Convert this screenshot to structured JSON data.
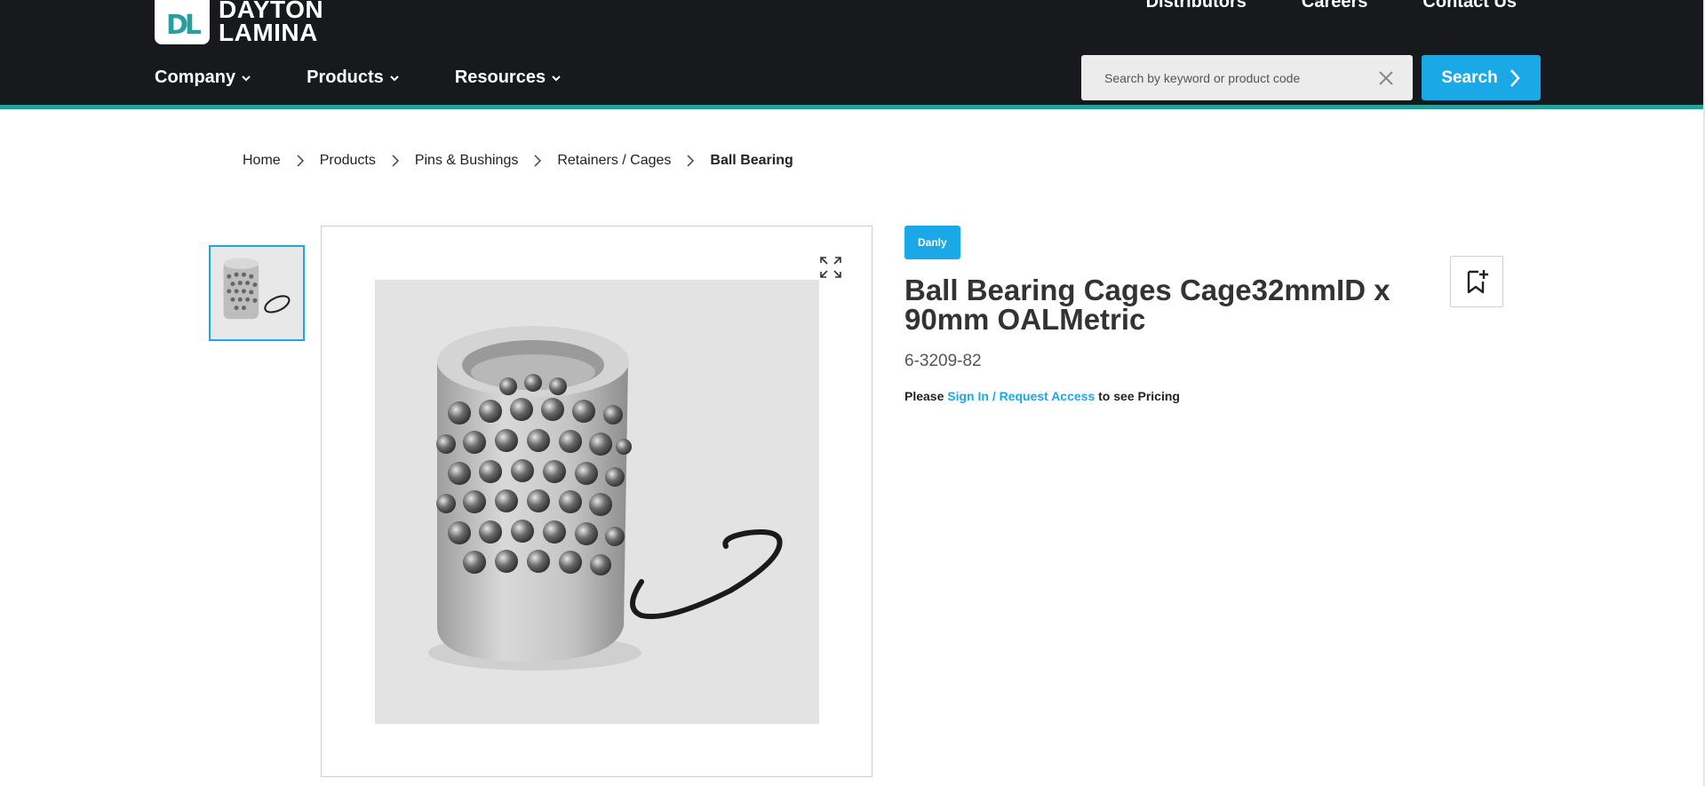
{
  "header": {
    "logo": {
      "line1": "DAYTON",
      "line2": "LAMINA",
      "mark": "DL"
    },
    "top_links": [
      "Distributors",
      "Careers",
      "Contact Us"
    ],
    "nav": [
      {
        "label": "Company",
        "icon": "chevron-down-icon"
      },
      {
        "label": "Products",
        "icon": "chevron-down-icon"
      },
      {
        "label": "Resources",
        "icon": "chevron-down-icon"
      }
    ],
    "search": {
      "placeholder": "Search by keyword or product code",
      "value": "",
      "button_label": "Search"
    }
  },
  "breadcrumb": [
    "Home",
    "Products",
    "Pins & Bushings",
    "Retainers / Cages",
    "Ball Bearing"
  ],
  "product": {
    "brand": "Danly",
    "title": "Ball Bearing Cages Cage32mmID x 90mm OALMetric",
    "sku": "6-3209-82",
    "pricing_prefix": "Please",
    "pricing_link": "Sign In / Request Access",
    "pricing_suffix": "to see Pricing"
  },
  "colors": {
    "header_bg": "#17191c",
    "header_accent": "#2a9d9d",
    "primary": "#1ba8e6"
  }
}
